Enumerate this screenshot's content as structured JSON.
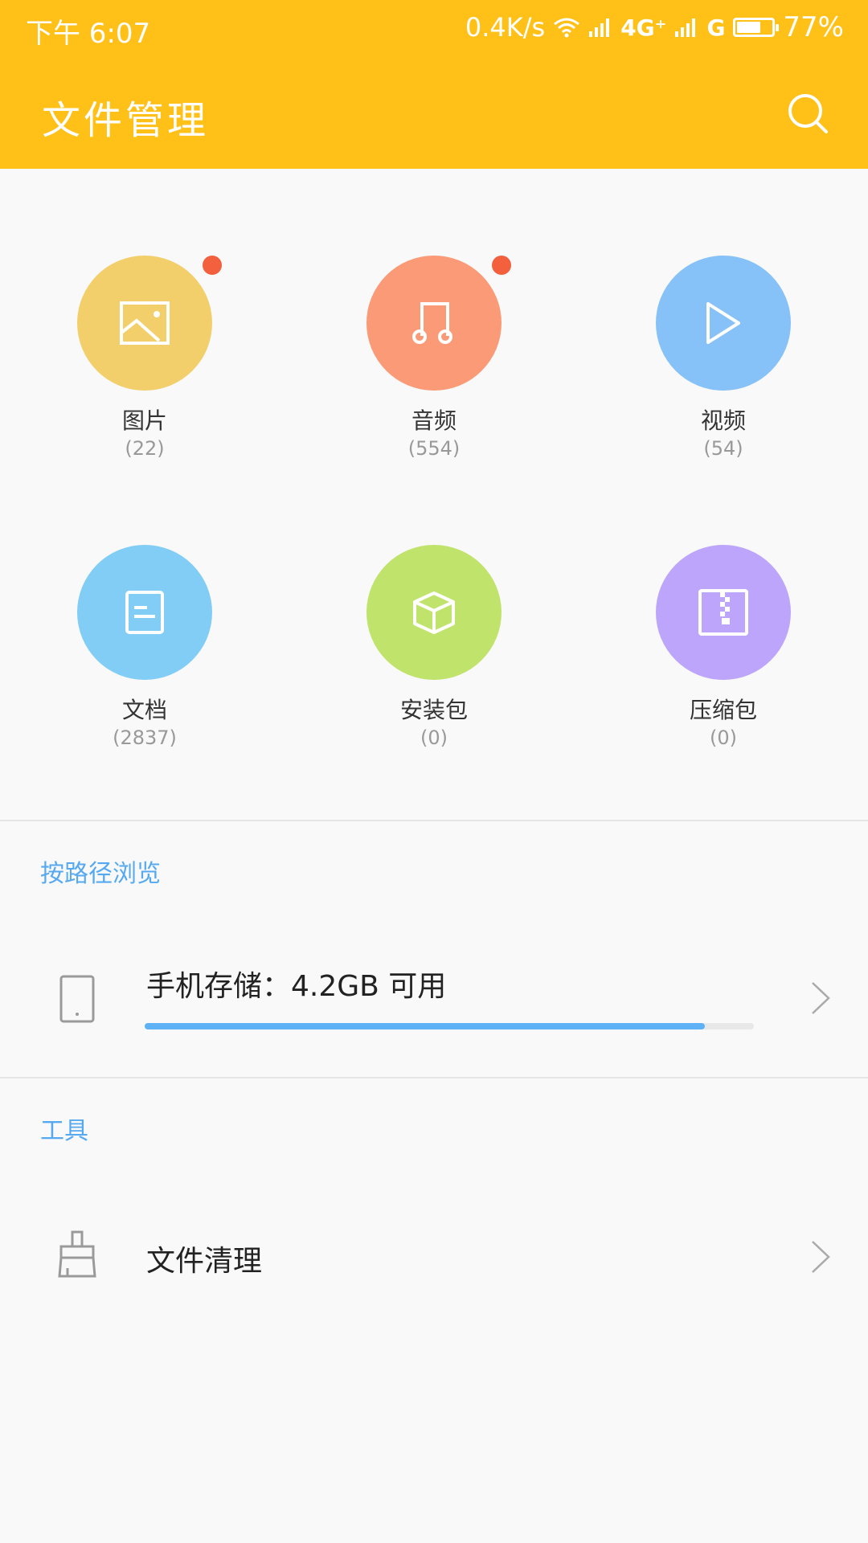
{
  "status_bar": {
    "time": "下午 6:07",
    "speed": "0.4K/s",
    "network": "4G⁺",
    "network2": "G",
    "battery": "77%",
    "battery_level": 0.77
  },
  "header": {
    "title": "文件管理",
    "search_icon": "search-icon"
  },
  "categories": [
    {
      "label": "图片",
      "count": "(22)",
      "color": "#f3cf6b",
      "icon": "image-icon",
      "badge": true
    },
    {
      "label": "音频",
      "count": "(554)",
      "color": "#fa9a77",
      "icon": "music-icon",
      "badge": true
    },
    {
      "label": "视频",
      "count": "(54)",
      "color": "#86c1f8",
      "icon": "play-icon",
      "badge": false
    },
    {
      "label": "文档",
      "count": "(2837)",
      "color": "#82cdf6",
      "icon": "document-icon",
      "badge": false
    },
    {
      "label": "安装包",
      "count": "(0)",
      "color": "#c0e36b",
      "icon": "package-icon",
      "badge": false
    },
    {
      "label": "压缩包",
      "count": "(0)",
      "color": "#bca5fb",
      "icon": "zip-icon",
      "badge": false
    }
  ],
  "browse": {
    "section_title": "按路径浏览",
    "storage_label": "手机存储：4.2GB 可用",
    "storage_used_fraction": 0.92
  },
  "tools": {
    "section_title": "工具",
    "clean_label": "文件清理"
  },
  "colors": {
    "accent": "#ffc018",
    "section": "#56a9f0",
    "badge": "#f2603e",
    "progress": "#60b2f6"
  }
}
